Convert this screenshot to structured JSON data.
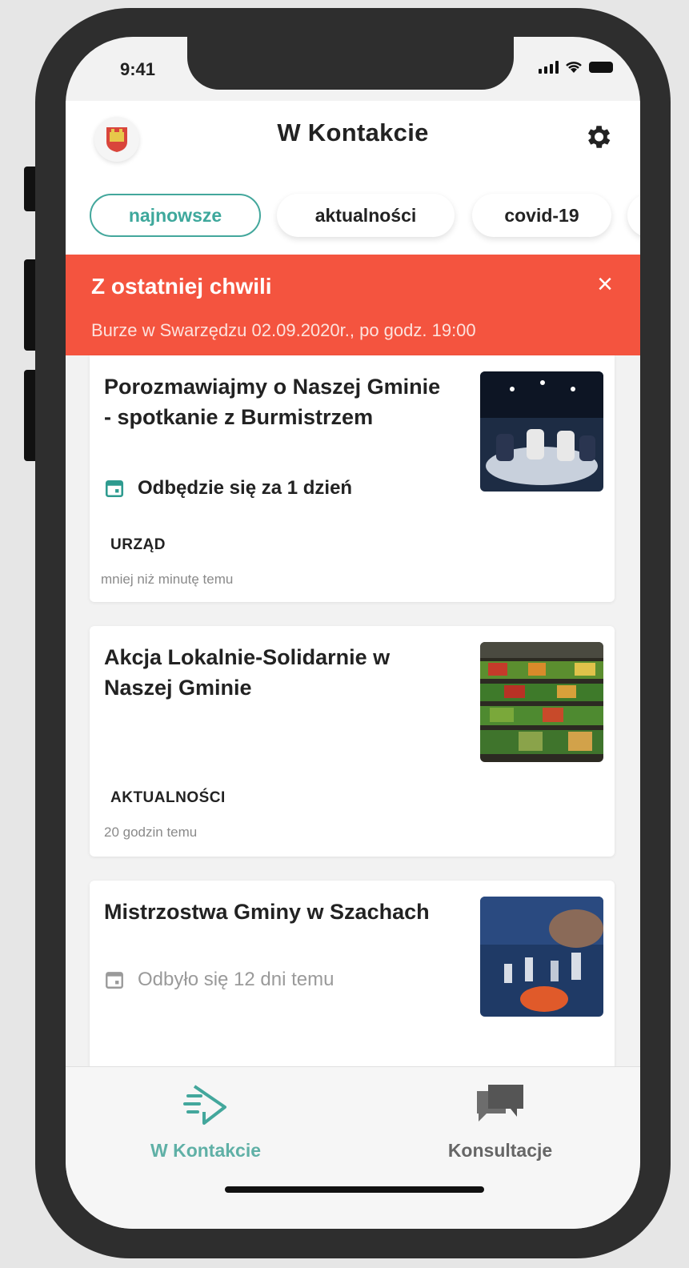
{
  "status_bar": {
    "time": "9:41"
  },
  "header": {
    "title": "W Kontakcie"
  },
  "tabs": [
    {
      "label": "najnowsze",
      "active": true
    },
    {
      "label": "aktualności",
      "active": false
    },
    {
      "label": "covid-19",
      "active": false
    }
  ],
  "alert": {
    "title": "Z ostatniej chwili",
    "close": "×",
    "text": "Burze w Swarzędzu 02.09.2020r., po godz. 19:00"
  },
  "cards": [
    {
      "title": "Porozmawiajmy o Naszej Gminie - spotkanie z Burmistrzem",
      "event": "Odbędzie się za 1 dzień",
      "category": "URZĄD",
      "time": "mniej niż minutę temu"
    },
    {
      "title": "Akcja Lokalnie-Solidarnie w Naszej Gminie",
      "category": "AKTUALNOŚCI",
      "time": "20 godzin temu"
    },
    {
      "title": "Mistrzostwa Gminy w Szachach",
      "event": "Odbyło się 12 dni temu"
    }
  ],
  "bottom_nav": [
    {
      "label": "W Kontakcie",
      "icon": "megaphone-icon",
      "active": true
    },
    {
      "label": "Konsultacje",
      "icon": "chat-bubbles-icon",
      "active": false
    }
  ],
  "colors": {
    "accent": "#43a79c",
    "alert": "#f4543f"
  }
}
